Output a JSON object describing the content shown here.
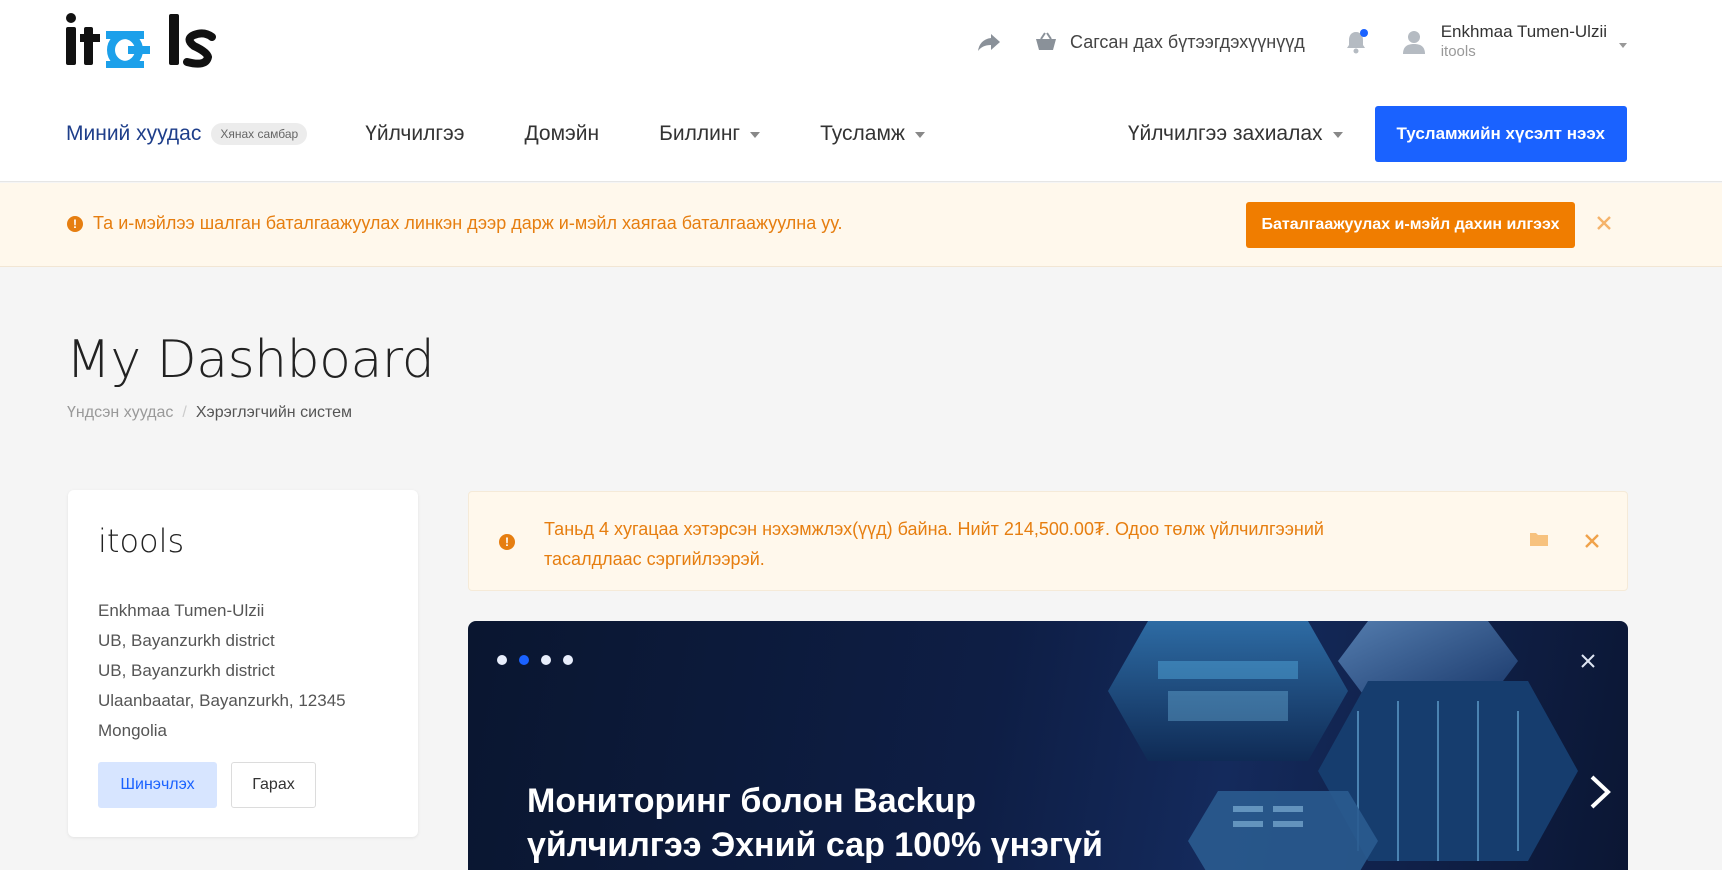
{
  "header": {
    "logo_text": "itools",
    "cart_label": "Сагсан дах бүтээгдэхүүнүүд",
    "notification_dot_color": "#1a62ff",
    "user": {
      "name": "Enkhmaa Tumen-Ulzii",
      "org": "itools"
    }
  },
  "nav": {
    "home_label": "Миний хуудас",
    "home_badge": "Хянах самбар",
    "items": [
      {
        "label": "Үйлчилгээ",
        "dropdown": false
      },
      {
        "label": "Домэйн",
        "dropdown": false
      },
      {
        "label": "Биллинг",
        "dropdown": true
      },
      {
        "label": "Тусламж",
        "dropdown": true
      }
    ],
    "order_label": "Үйлчилгээ захиалах",
    "support_button": "Тусламжийн хүсэлт нээх"
  },
  "verify_banner": {
    "text": "Та и-мэйлээ шалган баталгаажуулах линкэн дээр дарж и-мэйл хаягаа баталгаажуулна уу.",
    "button": "Баталгаажуулах и-мэйл дахин илгээх"
  },
  "page": {
    "title": "My Dashboard",
    "breadcrumb": {
      "home": "Үндсэн хуудас",
      "separator": "/",
      "current": "Хэрэглэгчийн систем"
    }
  },
  "profile_card": {
    "title": "itools",
    "lines": [
      "Enkhmaa Tumen-Ulzii",
      "UB, Bayanzurkh district",
      "UB, Bayanzurkh district",
      "Ulaanbaatar, Bayanzurkh, 12345",
      "Mongolia"
    ],
    "update_button": "Шинэчлэх",
    "logout_button": "Гарах"
  },
  "overdue_alert": {
    "text": "Таньд 4 хугацаа хэтэрсэн нэхэмжлэх(үүд) байна. Нийт 214,500.00₮. Одоо төлж үйлчилгээний тасалдлаас сэргийлээрэй."
  },
  "promo": {
    "slide_count": 4,
    "active_slide": 2,
    "headline_line1": "Мониторинг болон Backup",
    "headline_line2": "үйлчилгээ Эхний сар 100% үнэгүй"
  },
  "colors": {
    "brand_blue": "#1a62ff",
    "warning_orange": "#e67e10",
    "warning_bg": "#fff8ec"
  }
}
